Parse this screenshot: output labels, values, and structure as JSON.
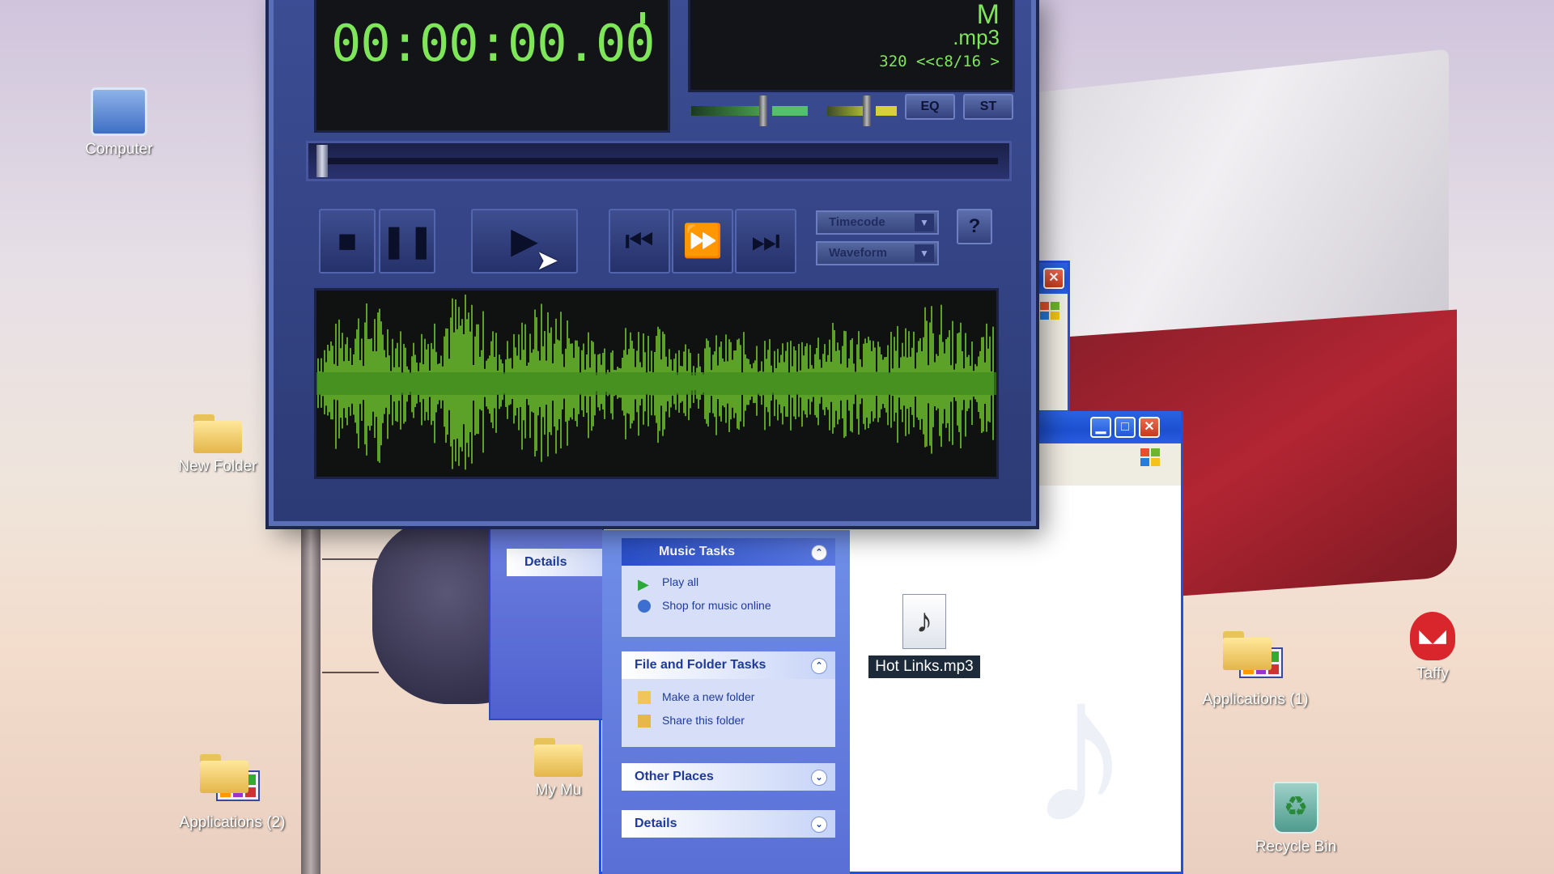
{
  "desktop": {
    "icons": [
      {
        "label": "Computer"
      },
      {
        "label": "New Folder"
      },
      {
        "label": "Applications (2)"
      },
      {
        "label": "My Mu"
      },
      {
        "label": "Applications (1)"
      },
      {
        "label": "Taffy"
      },
      {
        "label": "Recycle Bin"
      }
    ]
  },
  "player": {
    "timecode": "00:00:00.00",
    "mode_indicator": "M",
    "file_ext": ".mp3",
    "bitrate": "320 <<c8/16 >",
    "eq_button": "EQ",
    "st_button": "ST",
    "help_button": "?",
    "timecode_dropdown": "Timecode",
    "view_dropdown": "Waveform",
    "seek_position": 0,
    "colors": {
      "lcd_text": "#7fe65a",
      "waveform": "#6fc62e",
      "frame": "#2c3a75"
    }
  },
  "explorer": {
    "left_tab": "Details",
    "music_tasks": {
      "title": "Music Tasks",
      "items": [
        "Play all",
        "Shop for music online"
      ]
    },
    "file_folder_tasks": {
      "title": "File and Folder Tasks",
      "items": [
        "Make a new folder",
        "Share this folder"
      ]
    },
    "other_places": {
      "title": "Other Places"
    },
    "details": {
      "title": "Details"
    },
    "selected_file": "Hot Links.mp3"
  }
}
